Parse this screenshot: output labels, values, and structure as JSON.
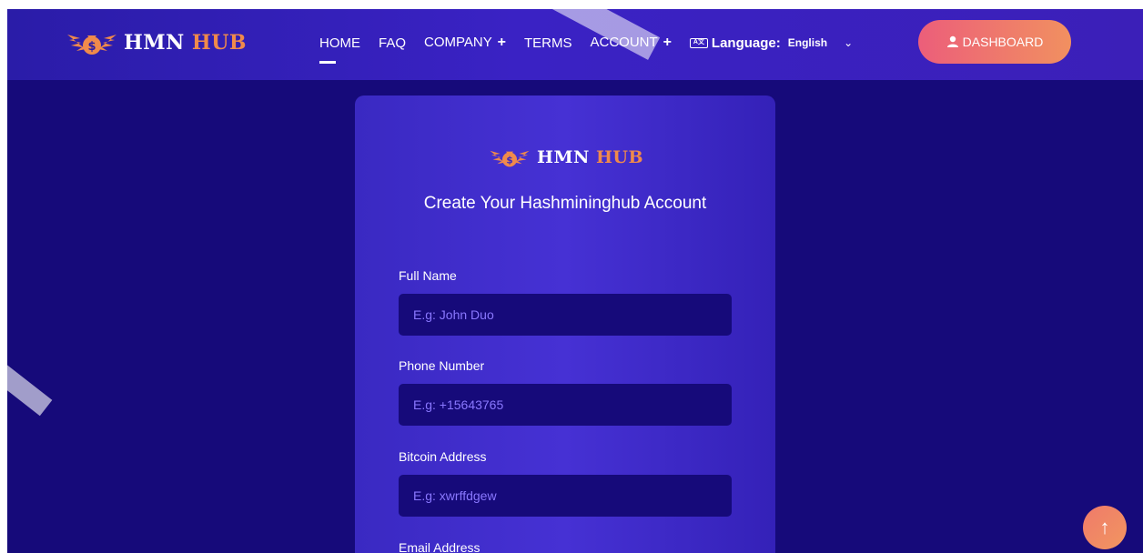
{
  "brand": {
    "name_white": "HMN",
    "name_orange": "HUB"
  },
  "nav": {
    "items": [
      {
        "label": "HOME",
        "plus": ""
      },
      {
        "label": "FAQ",
        "plus": ""
      },
      {
        "label": "COMPANY",
        "plus": "+"
      },
      {
        "label": "TERMS",
        "plus": ""
      },
      {
        "label": "ACCOUNT",
        "plus": "+"
      }
    ],
    "language_label": "Language:",
    "language_value": "English",
    "dashboard_label": "DASHBOARD"
  },
  "form": {
    "title": "Create Your Hashmininghub Account",
    "fields": [
      {
        "label": "Full Name",
        "placeholder": "E.g: John Duo"
      },
      {
        "label": "Phone Number",
        "placeholder": "E.g: +15643765"
      },
      {
        "label": "Bitcoin Address",
        "placeholder": "E.g: xwrffdgew"
      },
      {
        "label": "Email Address",
        "placeholder": ""
      }
    ]
  },
  "icons": {
    "logo": "money-bag-wings-logo",
    "language": "language-icon",
    "chevron": "chevron-down-icon",
    "user": "user-icon",
    "scroll_top": "arrow-up-icon"
  },
  "colors": {
    "background": "#160a7a",
    "nav_bg": "#3a22c4",
    "card_bg": "#4631d4",
    "accent_orange": "#f08a4b",
    "button_gradient_start": "#ec5e7a",
    "button_gradient_end": "#f19060"
  }
}
